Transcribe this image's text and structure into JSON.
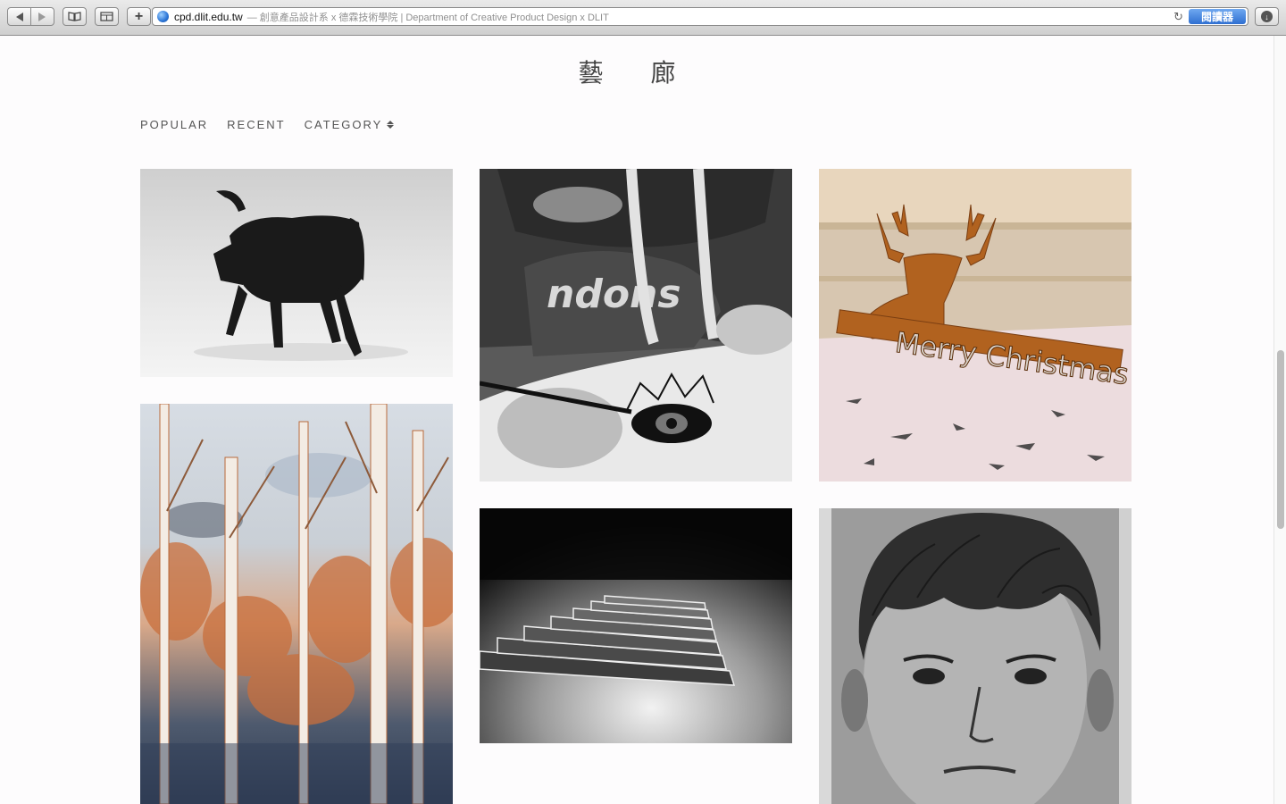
{
  "browser": {
    "url_host": "cpd.dlit.edu.tw",
    "url_title": "— 創意產品設計系 x 德霖技術學院 | Department of Creative Product Design x DLIT",
    "reader_label": "閱讀器",
    "plus_label": "+",
    "reload_glyph": "↻",
    "download_glyph": "↓"
  },
  "site": {
    "title": "藝 廊"
  },
  "nav": {
    "items": [
      {
        "label": "POPULAR"
      },
      {
        "label": "RECENT"
      },
      {
        "label": "CATEGORY"
      }
    ]
  },
  "gallery": {
    "tiles": [
      {
        "subject": "black wooden horse sculpture"
      },
      {
        "subject": "person drawing an eye"
      },
      {
        "subject": "deer Merry Christmas cutout",
        "caption": "Merry Christmas"
      },
      {
        "subject": "watercolor birch forest"
      },
      {
        "subject": "fanned playing cards"
      },
      {
        "subject": "charcoal boy portrait"
      }
    ]
  },
  "colors": {
    "accent": "#2f6fd1",
    "text": "#555555",
    "background": "#fdfcfd"
  }
}
